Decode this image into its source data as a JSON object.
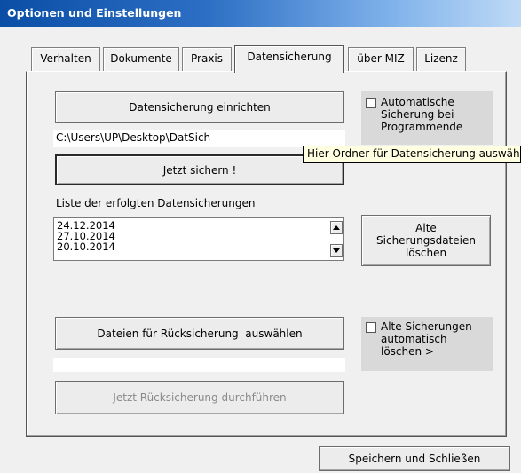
{
  "window": {
    "title": "Optionen und Einstellungen"
  },
  "tabs": [
    {
      "label": "Verhalten"
    },
    {
      "label": "Dokumente"
    },
    {
      "label": "Praxis"
    },
    {
      "label": "Datensicherung",
      "active": true
    },
    {
      "label": "über MIZ"
    },
    {
      "label": "Lizenz"
    }
  ],
  "backup": {
    "setup_button": "Datensicherung einrichten",
    "path_value": "C:\\Users\\UP\\Desktop\\DatSich",
    "save_now_button": "Jetzt sichern !",
    "auto_backup_checkbox": {
      "label": "Automatische Sicherung bei Programmende",
      "checked": false
    },
    "tooltip": "Hier Ordner für Datensicherung auswählen",
    "list_label": "Liste der erfolgten Datensicherungen",
    "list_items": [
      "24.12.2014",
      "27.10.2014",
      "20.10.2014"
    ],
    "delete_old_button": "Alte Sicherungsdateien löschen"
  },
  "restore": {
    "select_files_button": "Dateien für Rücksicherung  auswählen",
    "selected_files_value": "",
    "restore_now_button": "Jetzt Rücksicherung durchführen",
    "auto_delete_checkbox": {
      "label": "Alte Sicherungen automatisch löschen  >",
      "checked": false
    }
  },
  "footer": {
    "save_close_button": "Speichern und Schließen"
  }
}
